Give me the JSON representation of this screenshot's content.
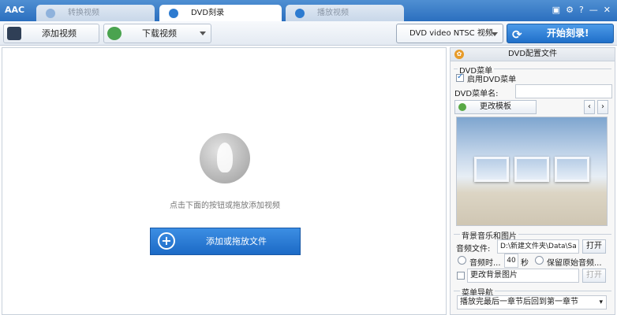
{
  "app": {
    "logo": "AAC"
  },
  "tabs": [
    {
      "label": "转换视频",
      "active": false
    },
    {
      "label": "DVD刻录",
      "active": true
    },
    {
      "label": "播放视频",
      "active": false
    }
  ],
  "window_controls": [
    "▣",
    "⚙",
    "?",
    "—",
    "✕"
  ],
  "toolbar": {
    "add_video": "添加视频",
    "download_video": "下载视频",
    "format_selected": "DVD video NTSC 视频",
    "start_burn": "开始刻录!"
  },
  "main": {
    "hint": "点击下面的按钮或拖放添加视频",
    "add_button": "添加或拖放文件"
  },
  "panel": {
    "title": "DVD配置文件",
    "dvd_menu_group": "DVD菜单",
    "enable_menu": "启用DVD菜单",
    "enable_menu_checked": true,
    "menu_name_label": "DVD菜单名:",
    "menu_name_value": "",
    "change_template": "更改模板",
    "bg_group": "背景音乐和图片",
    "audio_file_label": "音频文件:",
    "audio_file_value": "D:\\新建文件夹\\Data\\Sa",
    "open": "打开",
    "audio_duration_label": "音频时...",
    "audio_duration_value": "40",
    "seconds": "秒",
    "keep_original": "保留原始音频...",
    "change_bg": "更改背景图片",
    "open2": "打开",
    "nav_group": "菜单导航",
    "nav_selected": "播放完最后一章节后回到第一章节"
  }
}
